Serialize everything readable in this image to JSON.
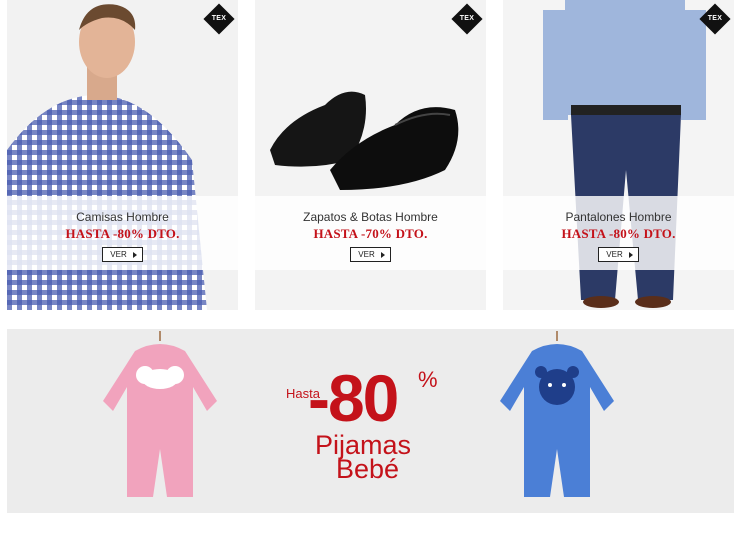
{
  "categories": [
    {
      "title": "Camisas Hombre",
      "discount": "HASTA -80% DTO.",
      "button": "VER",
      "badge": "TEX"
    },
    {
      "title": "Zapatos & Botas Hombre",
      "discount": "HASTA -70% DTO.",
      "button": "VER",
      "badge": "TEX"
    },
    {
      "title": "Pantalones Hombre",
      "discount": "HASTA -80% DTO.",
      "button": "VER",
      "badge": "TEX"
    }
  ],
  "promo": {
    "hasta": "Hasta",
    "number": "-80",
    "percent": "%",
    "line1": "Pijamas",
    "line2": "Bebé"
  },
  "colors": {
    "accent": "#c4121a",
    "badge": "#111111",
    "pink_pajama": "#f1a3bd",
    "blue_pajama": "#4b7fd6"
  }
}
